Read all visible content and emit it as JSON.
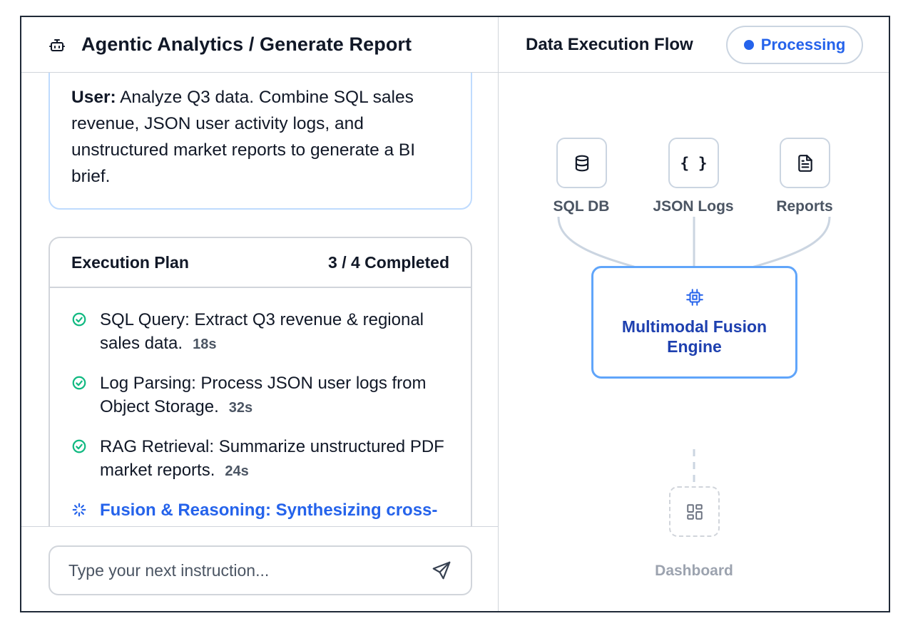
{
  "header": {
    "title": "Agentic Analytics / Generate Report",
    "icon": "robot-icon"
  },
  "user_message": {
    "prefix": "User:",
    "text": " Analyze Q3 data. Combine SQL sales revenue, JSON user activity logs, and unstructured market reports to generate a BI brief."
  },
  "plan": {
    "title": "Execution Plan",
    "progress": "3 / 4 Completed",
    "steps": [
      {
        "text": "SQL Query: Extract Q3 revenue & regional sales data.",
        "duration": "18s",
        "status": "completed"
      },
      {
        "text": "Log Parsing: Process JSON user logs from Object Storage.",
        "duration": "32s",
        "status": "completed"
      },
      {
        "text": "RAG Retrieval: Summarize unstructured PDF market reports.",
        "duration": "24s",
        "status": "completed"
      },
      {
        "text": "Fusion & Reasoning: Synthesizing cross-modal data...",
        "duration": "",
        "status": "in-progress"
      }
    ]
  },
  "input": {
    "placeholder": "Type your next instruction...",
    "value": ""
  },
  "flow": {
    "title": "Data Execution Flow",
    "status": "Processing",
    "sources": [
      {
        "label": "SQL DB",
        "icon": "database-icon"
      },
      {
        "label": "JSON Logs",
        "icon": "braces-icon",
        "glyph": "{ }"
      },
      {
        "label": "Reports",
        "icon": "document-icon"
      }
    ],
    "engine": {
      "label": "Multimodal Fusion Engine",
      "icon": "chip-icon"
    },
    "output": {
      "label": "Dashboard",
      "icon": "dashboard-icon"
    }
  },
  "colors": {
    "accent": "#2563eb",
    "engine_border": "#60a5fa",
    "engine_text": "#1e40af",
    "success": "#10b981",
    "user_card_border": "#bfdbfe"
  }
}
